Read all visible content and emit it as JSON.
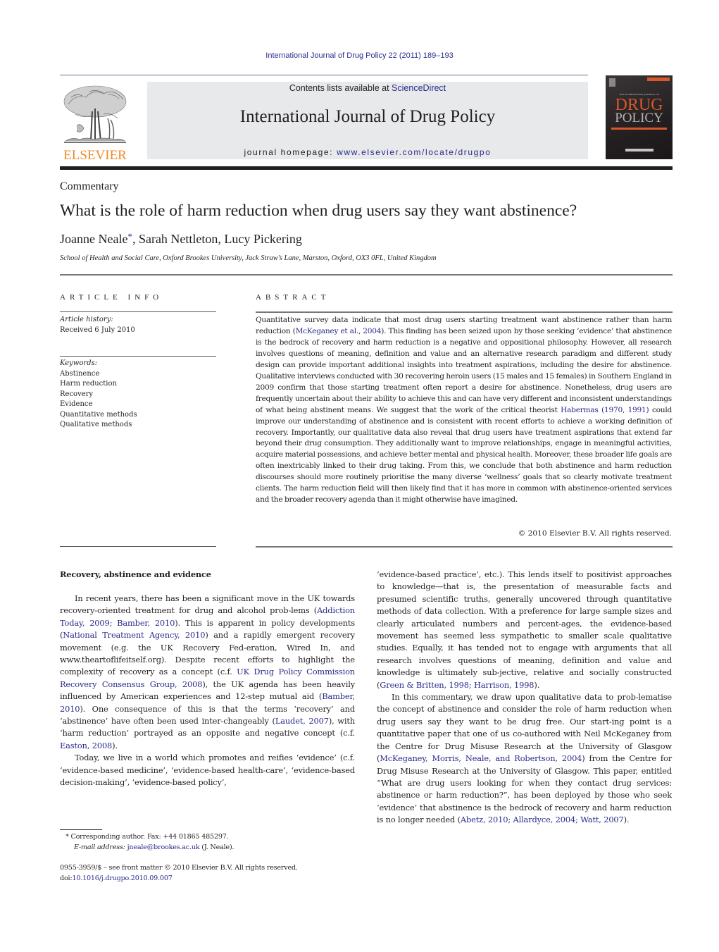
{
  "header": {
    "running_head": "International Journal of Drug Policy 22 (2011) 189–193",
    "contents_prefix": "Contents lists available at ",
    "contents_link": "ScienceDirect",
    "journal_title": "International Journal of Drug Policy",
    "homepage_prefix": "journal homepage: ",
    "homepage_link": "www.elsevier.com/locate/drugpo",
    "publisher_logo_text": "ELSEVIER",
    "cover": {
      "title_top": "DRUG",
      "title_bottom": "POLICY",
      "subtitle": "THE INTERNATIONAL JOURNAL OF"
    }
  },
  "article": {
    "type": "Commentary",
    "title": "What is the role of harm reduction when drug users say they want abstinence?",
    "authors": [
      {
        "name": "Joanne Neale",
        "marker": "*"
      },
      {
        "name": "Sarah Nettleton",
        "marker": ""
      },
      {
        "name": "Lucy Pickering",
        "marker": ""
      }
    ],
    "author_separator": ", ",
    "affiliation": "School of Health and Social Care, Oxford Brookes University, Jack Straw’s Lane, Marston, Oxford, OX3 0FL, United Kingdom"
  },
  "article_info": {
    "heading": "ARTICLE INFO",
    "history_label": "Article history:",
    "received": "Received 6 July 2010",
    "keywords_label": "Keywords:",
    "keywords": [
      "Abstinence",
      "Harm reduction",
      "Recovery",
      "Evidence",
      "Quantitative methods",
      "Qualitative methods"
    ]
  },
  "abstract": {
    "heading": "ABSTRACT",
    "segments": [
      {
        "t": "Quantitative survey data indicate that most drug users starting treatment want abstinence rather than harm reduction ("
      },
      {
        "t": "McKeganey et al., 2004",
        "link": true
      },
      {
        "t": "). This finding has been seized upon by those seeking ‘evidence’ that abstinence is the bedrock of recovery and harm reduction is a negative and oppositional philosophy. However, all research involves questions of meaning, definition and value and an alternative research paradigm and different study design can provide important additional insights into treatment aspirations, including the desire for abstinence. Qualitative interviews conducted with 30 recovering heroin users (15 males and 15 females) in Southern England in 2009 confirm that those starting treatment often report a desire for abstinence. Nonetheless, drug users are frequently uncertain about their ability to achieve this and can have very different and inconsistent understandings of what being abstinent means. We suggest that the work of the critical theorist "
      },
      {
        "t": "Habermas (1970, 1991)",
        "link": true
      },
      {
        "t": " could improve our understanding of abstinence and is consistent with recent efforts to achieve a working definition of recovery. Importantly, our qualitative data also reveal that drug users have treatment aspirations that extend far beyond their drug consumption. They additionally want to improve relationships, engage in meaningful activities, acquire material possessions, and achieve better mental and physical health. Moreover, these broader life goals are often inextricably linked to their drug taking. From this, we conclude that both abstinence and harm reduction discourses should more routinely prioritise the many diverse ‘wellness’ goals that so clearly motivate treatment clients. The harm reduction field will then likely find that it has more in common with abstinence-oriented services and the broader recovery agenda than it might otherwise have imagined."
      }
    ],
    "copyright": "© 2010 Elsevier B.V. All rights reserved."
  },
  "body": {
    "section_heading": "Recovery, abstinence and evidence",
    "left_paragraphs": [
      [
        {
          "t": "In recent years, there has been a significant move in the UK towards recovery-oriented treatment for drug and alcohol prob-lems ("
        },
        {
          "t": "Addiction Today, 2009; Bamber, 2010",
          "link": true
        },
        {
          "t": "). This is apparent in policy developments ("
        },
        {
          "t": "National Treatment Agency, 2010",
          "link": true
        },
        {
          "t": ") and a rapidly emergent recovery movement (e.g. the UK Recovery Fed-eration, Wired In, and www.theartoflifeitself.org). Despite recent efforts to highlight the complexity of recovery as a concept (c.f. "
        },
        {
          "t": "UK Drug Policy Commission Recovery Consensus Group, 2008",
          "link": true
        },
        {
          "t": "), the UK agenda has been heavily influenced by American experiences and 12-step mutual aid ("
        },
        {
          "t": "Bamber, 2010",
          "link": true
        },
        {
          "t": "). One consequence of this is that the terms ‘recovery’ and ‘abstinence’ have often been used inter-changeably ("
        },
        {
          "t": "Laudet, 2007",
          "link": true
        },
        {
          "t": "), with ‘harm reduction’ portrayed as an opposite and negative concept (c.f. "
        },
        {
          "t": "Easton, 2008",
          "link": true
        },
        {
          "t": ")."
        }
      ],
      [
        {
          "t": "Today, we live in a world which promotes and reifies ‘evidence’ (c.f. ‘evidence-based medicine’, ‘evidence-based health-care’, ‘evidence-based decision-making’, ‘evidence-based policy’,"
        }
      ]
    ],
    "right_paragraphs": [
      [
        {
          "t": "‘evidence-based practice’, etc.). This lends itself to positivist approaches to knowledge—that is, the presentation of measurable facts and presumed scientific truths, generally uncovered through quantitative methods of data collection. With a preference for large sample sizes and clearly articulated numbers and percent-ages, the evidence-based movement has seemed less sympathetic to smaller scale qualitative studies. Equally, it has tended not to engage with arguments that all research involves questions of meaning, definition and value and knowledge is ultimately sub-jective, relative and socially constructed ("
        },
        {
          "t": "Green & Britten, 1998; Harrison, 1998",
          "link": true
        },
        {
          "t": ")."
        }
      ],
      [
        {
          "t": "In this commentary, we draw upon qualitative data to prob-lematise the concept of abstinence and consider the role of harm reduction when drug users say they want to be drug free. Our start-ing point is a quantitative paper that one of us co-authored with Neil McKeganey from the Centre for Drug Misuse Research at the University of Glasgow ("
        },
        {
          "t": "McKeganey, Morris, Neale, and Robertson, 2004",
          "link": true
        },
        {
          "t": ") from the Centre for Drug Misuse Research at the University of Glasgow. This paper, entitled “What are drug users looking for when they contact drug services: abstinence or harm reduction?”, has been deployed by those who seek ‘evidence’ that abstinence is the bedrock of recovery and harm reduction is no longer needed ("
        },
        {
          "t": "Abetz, 2010; Allardyce, 2004; Watt, 2007",
          "link": true
        },
        {
          "t": ")."
        }
      ]
    ]
  },
  "footnotes": {
    "corresponding": "* Corresponding author. Fax: +44 01865 485297.",
    "email_label": "E-mail address:",
    "email": "jneale@brookes.ac.uk",
    "email_suffix": " (J. Neale).",
    "front_matter": "0955-3959/$ – see front matter © 2010 Elsevier B.V. All rights reserved.",
    "doi_prefix": "doi:",
    "doi": "10.1016/j.drugpo.2010.09.007"
  },
  "colors": {
    "link": "#2a2a8c",
    "elsevier_orange": "#f08a24",
    "cover_accent": "#d9582b",
    "masthead_bg": "#e8e9eb"
  }
}
